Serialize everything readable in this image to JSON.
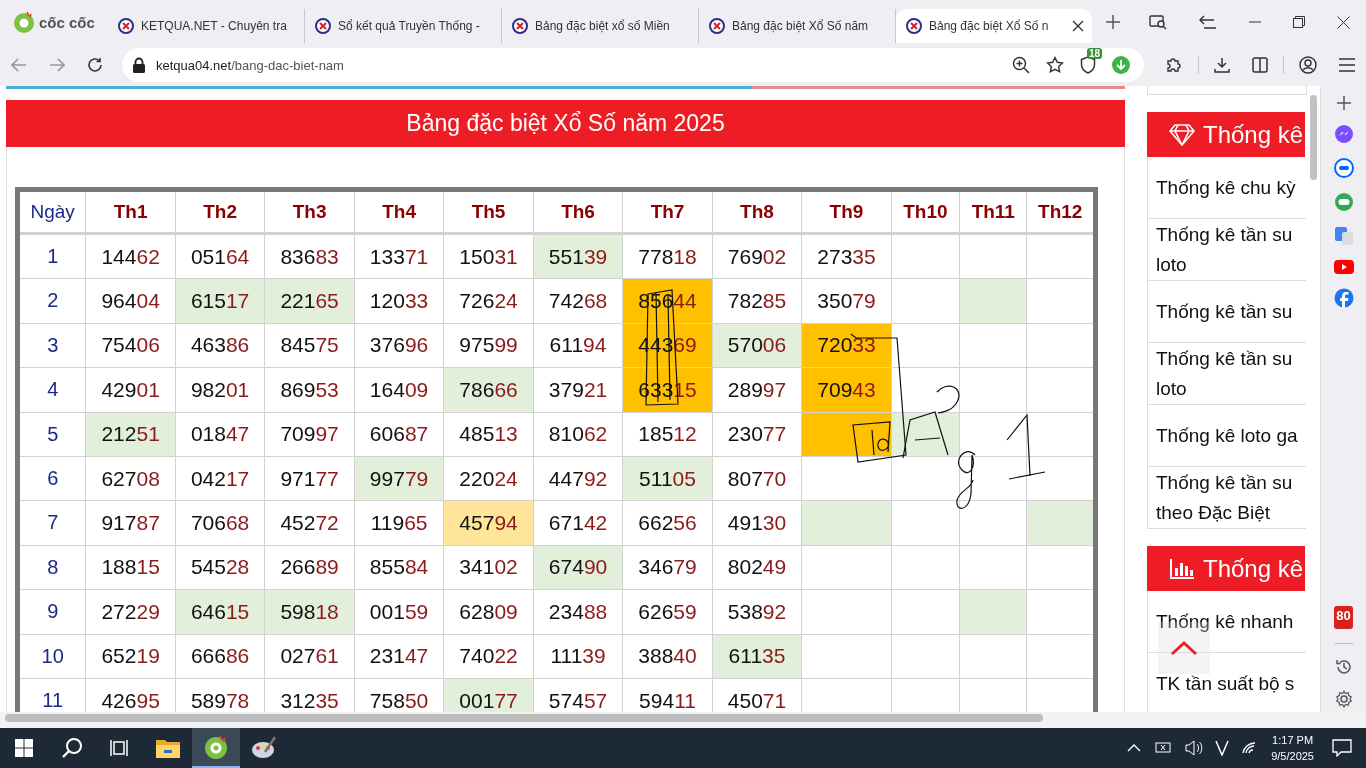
{
  "browser": {
    "logo": "cốc cốc",
    "tabs": [
      {
        "title": "KETQUA.NET - Chuyên tra",
        "selected": false
      },
      {
        "title": "Sổ kết quả Truyền Thống -",
        "selected": false
      },
      {
        "title": "Bảng đặc biệt xổ số Miền",
        "selected": false
      },
      {
        "title": "Bảng đặc biệt Xổ Số năm",
        "selected": false
      },
      {
        "title": "Bảng đặc biệt Xổ Số n",
        "selected": true
      }
    ],
    "address": {
      "domain": "ketqua04.net",
      "path": "/bang-dac-biet-nam"
    },
    "shield_count": "18"
  },
  "page": {
    "title": "Bảng đặc biệt Xổ Số năm 2025",
    "table": {
      "columns": [
        "Ngày",
        "Th1",
        "Th2",
        "Th3",
        "Th4",
        "Th5",
        "Th6",
        "Th7",
        "Th8",
        "Th9",
        "Th10",
        "Th11",
        "Th12"
      ],
      "rows": [
        {
          "cells": [
            {
              "value": "1"
            },
            {
              "value": "14462"
            },
            {
              "value": "05164"
            },
            {
              "value": "83683"
            },
            {
              "value": "13371"
            },
            {
              "value": "15031"
            },
            {
              "value": "55139",
              "color": "#e2efda"
            },
            {
              "value": "77818"
            },
            {
              "value": "76902"
            },
            {
              "value": "27335"
            },
            null,
            null,
            null
          ]
        },
        {
          "cells": [
            {
              "value": "2"
            },
            {
              "value": "96404"
            },
            {
              "value": "61517",
              "color": "#e2efda"
            },
            {
              "value": "22165",
              "color": "#e2efda"
            },
            {
              "value": "12033"
            },
            {
              "value": "72624"
            },
            {
              "value": "74268"
            },
            {
              "value": "85644",
              "color": "#ffc000"
            },
            {
              "value": "78285"
            },
            {
              "value": "35079"
            },
            null,
            {
              "color": "#e2efda"
            },
            null
          ]
        },
        {
          "cells": [
            {
              "value": "3"
            },
            {
              "value": "75406"
            },
            {
              "value": "46386"
            },
            {
              "value": "84575"
            },
            {
              "value": "37696"
            },
            {
              "value": "97599"
            },
            {
              "value": "61194"
            },
            {
              "value": "44369",
              "color": "#ffc000"
            },
            {
              "value": "57006",
              "color": "#e2efda"
            },
            {
              "value": "72033",
              "color": "#ffc000"
            },
            null,
            null,
            null
          ]
        },
        {
          "cells": [
            {
              "value": "4"
            },
            {
              "value": "42901"
            },
            {
              "value": "98201"
            },
            {
              "value": "86953"
            },
            {
              "value": "16409"
            },
            {
              "value": "78666",
              "color": "#e2efda"
            },
            {
              "value": "37921"
            },
            {
              "value": "63315",
              "color": "#ffc000"
            },
            {
              "value": "28997"
            },
            {
              "value": "70943",
              "color": "#ffc000"
            },
            null,
            null,
            null
          ]
        },
        {
          "cells": [
            {
              "value": "5"
            },
            {
              "value": "21251",
              "color": "#e2efda"
            },
            {
              "value": "01847"
            },
            {
              "value": "70997"
            },
            {
              "value": "60687"
            },
            {
              "value": "48513"
            },
            {
              "value": "81062"
            },
            {
              "value": "18512"
            },
            {
              "value": "23077"
            },
            {
              "color": "#ffc000"
            },
            {
              "color": "#e2efda"
            },
            null,
            null
          ]
        },
        {
          "cells": [
            {
              "value": "6"
            },
            {
              "value": "62708"
            },
            {
              "value": "04217"
            },
            {
              "value": "97177"
            },
            {
              "value": "99779",
              "color": "#e2efda"
            },
            {
              "value": "22024"
            },
            {
              "value": "44792"
            },
            {
              "value": "51105",
              "color": "#e2efda"
            },
            {
              "value": "80770"
            },
            null,
            null,
            null,
            null
          ]
        },
        {
          "cells": [
            {
              "value": "7"
            },
            {
              "value": "91787"
            },
            {
              "value": "70668"
            },
            {
              "value": "45272"
            },
            {
              "value": "11965"
            },
            {
              "value": "45794",
              "color": "#ffe599"
            },
            {
              "value": "67142"
            },
            {
              "value": "66256"
            },
            {
              "value": "49130"
            },
            {
              "color": "#e2efda"
            },
            null,
            null,
            {
              "color": "#e2efda"
            }
          ]
        },
        {
          "cells": [
            {
              "value": "8"
            },
            {
              "value": "18815"
            },
            {
              "value": "54528"
            },
            {
              "value": "26689"
            },
            {
              "value": "85584"
            },
            {
              "value": "34102"
            },
            {
              "value": "67490",
              "color": "#e2efda"
            },
            {
              "value": "34679"
            },
            {
              "value": "80249"
            },
            null,
            null,
            null,
            null
          ]
        },
        {
          "cells": [
            {
              "value": "9"
            },
            {
              "value": "27229"
            },
            {
              "value": "64615",
              "color": "#e2efda"
            },
            {
              "value": "59818",
              "color": "#e2efda"
            },
            {
              "value": "00159"
            },
            {
              "value": "62809"
            },
            {
              "value": "23488"
            },
            {
              "value": "62659"
            },
            {
              "value": "53892"
            },
            null,
            null,
            {
              "color": "#e2efda"
            },
            null
          ]
        },
        {
          "cells": [
            {
              "value": "10"
            },
            {
              "value": "65219"
            },
            {
              "value": "66686"
            },
            {
              "value": "02761"
            },
            {
              "value": "23147"
            },
            {
              "value": "74022"
            },
            {
              "value": "11139"
            },
            {
              "value": "38840"
            },
            {
              "value": "61135",
              "color": "#e2efda"
            },
            null,
            null,
            null,
            null
          ]
        },
        {
          "cells": [
            {
              "value": "11"
            },
            {
              "value": "42695"
            },
            {
              "value": "58978"
            },
            {
              "value": "31235"
            },
            {
              "value": "75850"
            },
            {
              "value": "00177",
              "color": "#e2efda"
            },
            {
              "value": "57457"
            },
            {
              "value": "59411"
            },
            {
              "value": "45071"
            },
            null,
            null,
            null,
            null
          ]
        }
      ]
    }
  },
  "sidebar": {
    "sections": [
      {
        "kind": "diamond",
        "heading": "Thống kê",
        "items": [
          "Thống kê chu kỳ",
          "Thống kê tần su\nloto",
          "Thống kê tần su",
          "Thống kê tần su\nloto",
          "Thống kê loto ga",
          "Thống kê tần su\ntheo Đặc Biệt"
        ]
      },
      {
        "kind": "chart",
        "heading": "Thống kê",
        "items": [
          "Thống kê nhanh",
          "TK tần suất bộ s"
        ]
      }
    ]
  },
  "side_panel": {
    "badge": "80"
  },
  "taskbar": {
    "apps": [
      {
        "kind": "start",
        "selected": false
      },
      {
        "kind": "search",
        "selected": false
      },
      {
        "kind": "task-view",
        "selected": false
      },
      {
        "kind": "folder",
        "selected": false
      },
      {
        "kind": "browser",
        "selected": true
      },
      {
        "kind": "paint",
        "selected": false
      }
    ],
    "time": "1:17 PM",
    "date": "9/5/2025"
  }
}
